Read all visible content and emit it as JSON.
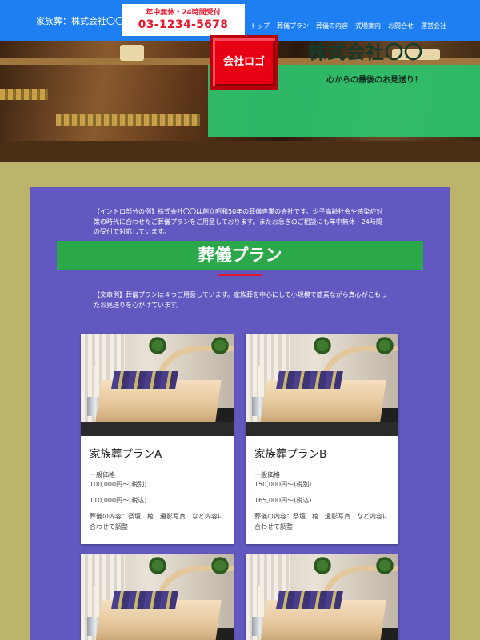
{
  "header": {
    "site_name": "家族葬：株式会社〇〇",
    "phone_note": "年中無休・24時間受付",
    "phone_number": "03-1234-5678",
    "nav": [
      "トップ",
      "葬儀プラン",
      "葬儀の内容",
      "式場案内",
      "お問合せ",
      "運営会社"
    ]
  },
  "hero": {
    "logo_text": "会社ロゴ",
    "company_name": "株式会社〇〇",
    "tagline": "心からの最後のお見送り！"
  },
  "main": {
    "intro": "【イントロ部分の例】株式会社〇〇は創立昭和50年の葬儀専業の会社です。少子高齢社会や感染症対策の時代に合わせたご葬儀プランをご用意しております。またお急ぎのご相談にも年中無休・24時間の受付で対応しています。",
    "section_title": "葬儀プラン",
    "plan_lead": "【文章例】葬儀プランは４つご用意しています。家族葬を中心にして小規模で簡素ながら真心がこもったお見送りを心がけています。",
    "plans": [
      {
        "name": "家族葬プランA",
        "price_label": "一般価格",
        "price_tax_excluded": "100,000円〜(税別)",
        "price_tax_included": "110,000円〜(税込)",
        "contents": "葬儀の内容：祭壇　棺　遺影写真　など内容に合わせて調整"
      },
      {
        "name": "家族葬プランB",
        "price_label": "一般価格",
        "price_tax_excluded": "150,000円〜(税別)",
        "price_tax_included": "165,000円〜(税込)",
        "contents": "葬儀の内容：祭壇　棺　遺影写真　など内容に合わせて調整"
      }
    ]
  },
  "colors": {
    "header_bg": "#1e7ff2",
    "accent_red": "#e8182d",
    "hero_green": "#2ec46e",
    "panel_purple": "#6259c0",
    "title_green": "#2aa84a",
    "page_bg": "#bdb46b"
  }
}
